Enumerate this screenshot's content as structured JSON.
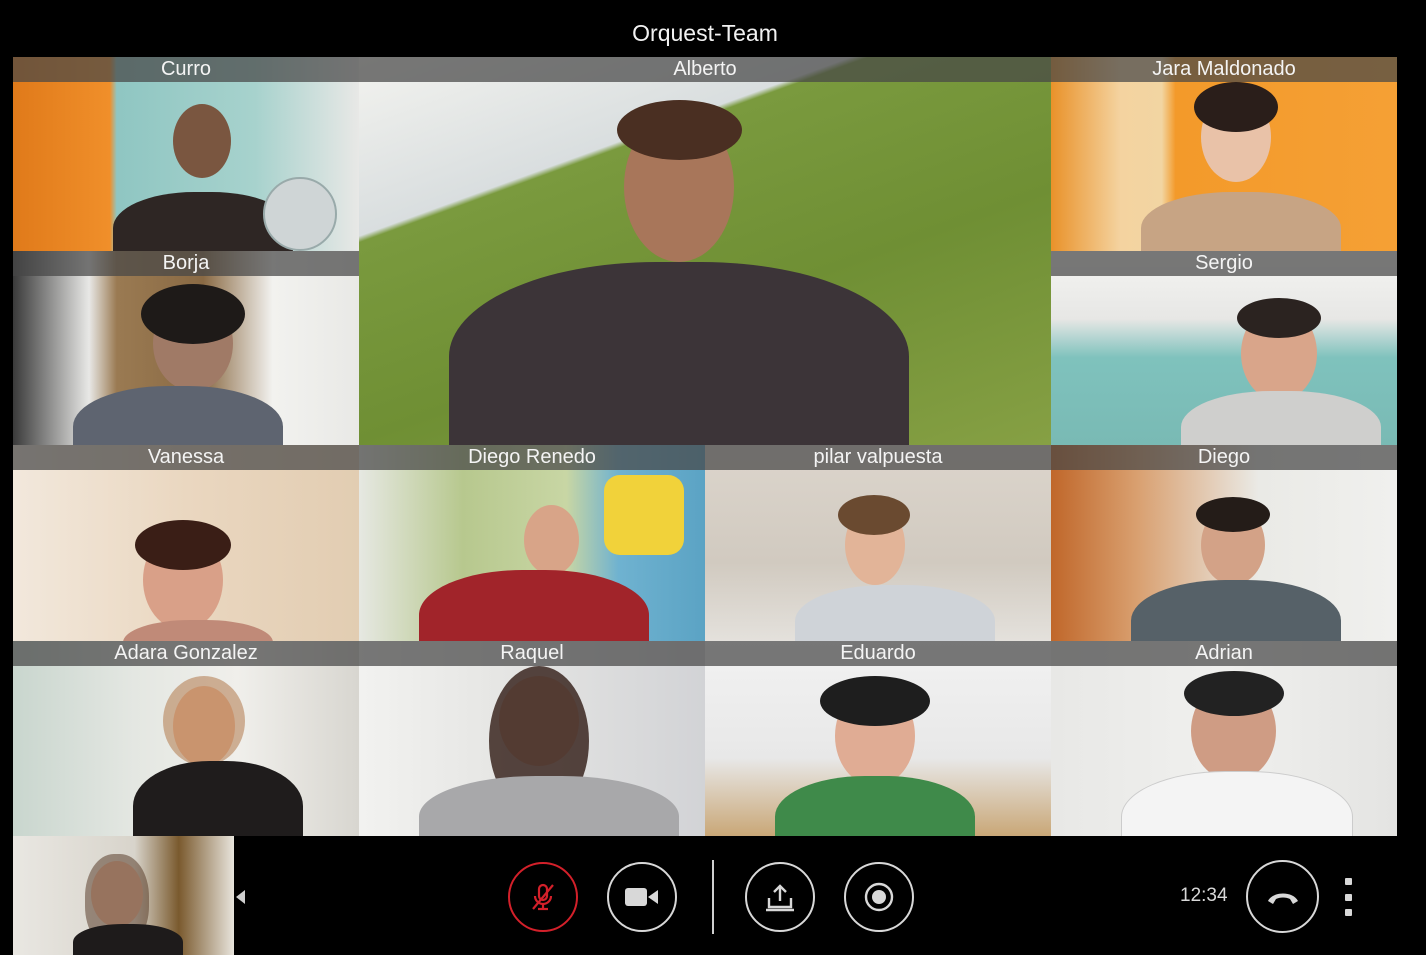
{
  "window": {
    "title": "Orquest-Team"
  },
  "participants": [
    {
      "name": "Curro"
    },
    {
      "name": "Alberto"
    },
    {
      "name": "Jara Maldonado"
    },
    {
      "name": "Borja"
    },
    {
      "name": "Sergio"
    },
    {
      "name": "Vanessa"
    },
    {
      "name": "Diego Renedo"
    },
    {
      "name": "pilar valpuesta"
    },
    {
      "name": "Diego"
    },
    {
      "name": "Adara Gonzalez"
    },
    {
      "name": "Raquel"
    },
    {
      "name": "Eduardo"
    },
    {
      "name": "Adrian"
    }
  ],
  "controls": {
    "mute_icon": "microphone-muted-icon",
    "camera_icon": "video-camera-icon",
    "share_icon": "screen-share-icon",
    "record_icon": "record-icon",
    "hangup_icon": "hang-up-phone-icon",
    "more_icon": "more-vertical-icon"
  },
  "status": {
    "time": "12:34"
  },
  "colors": {
    "accent_red": "#d3202a",
    "control_stroke": "#d8d8d8"
  }
}
